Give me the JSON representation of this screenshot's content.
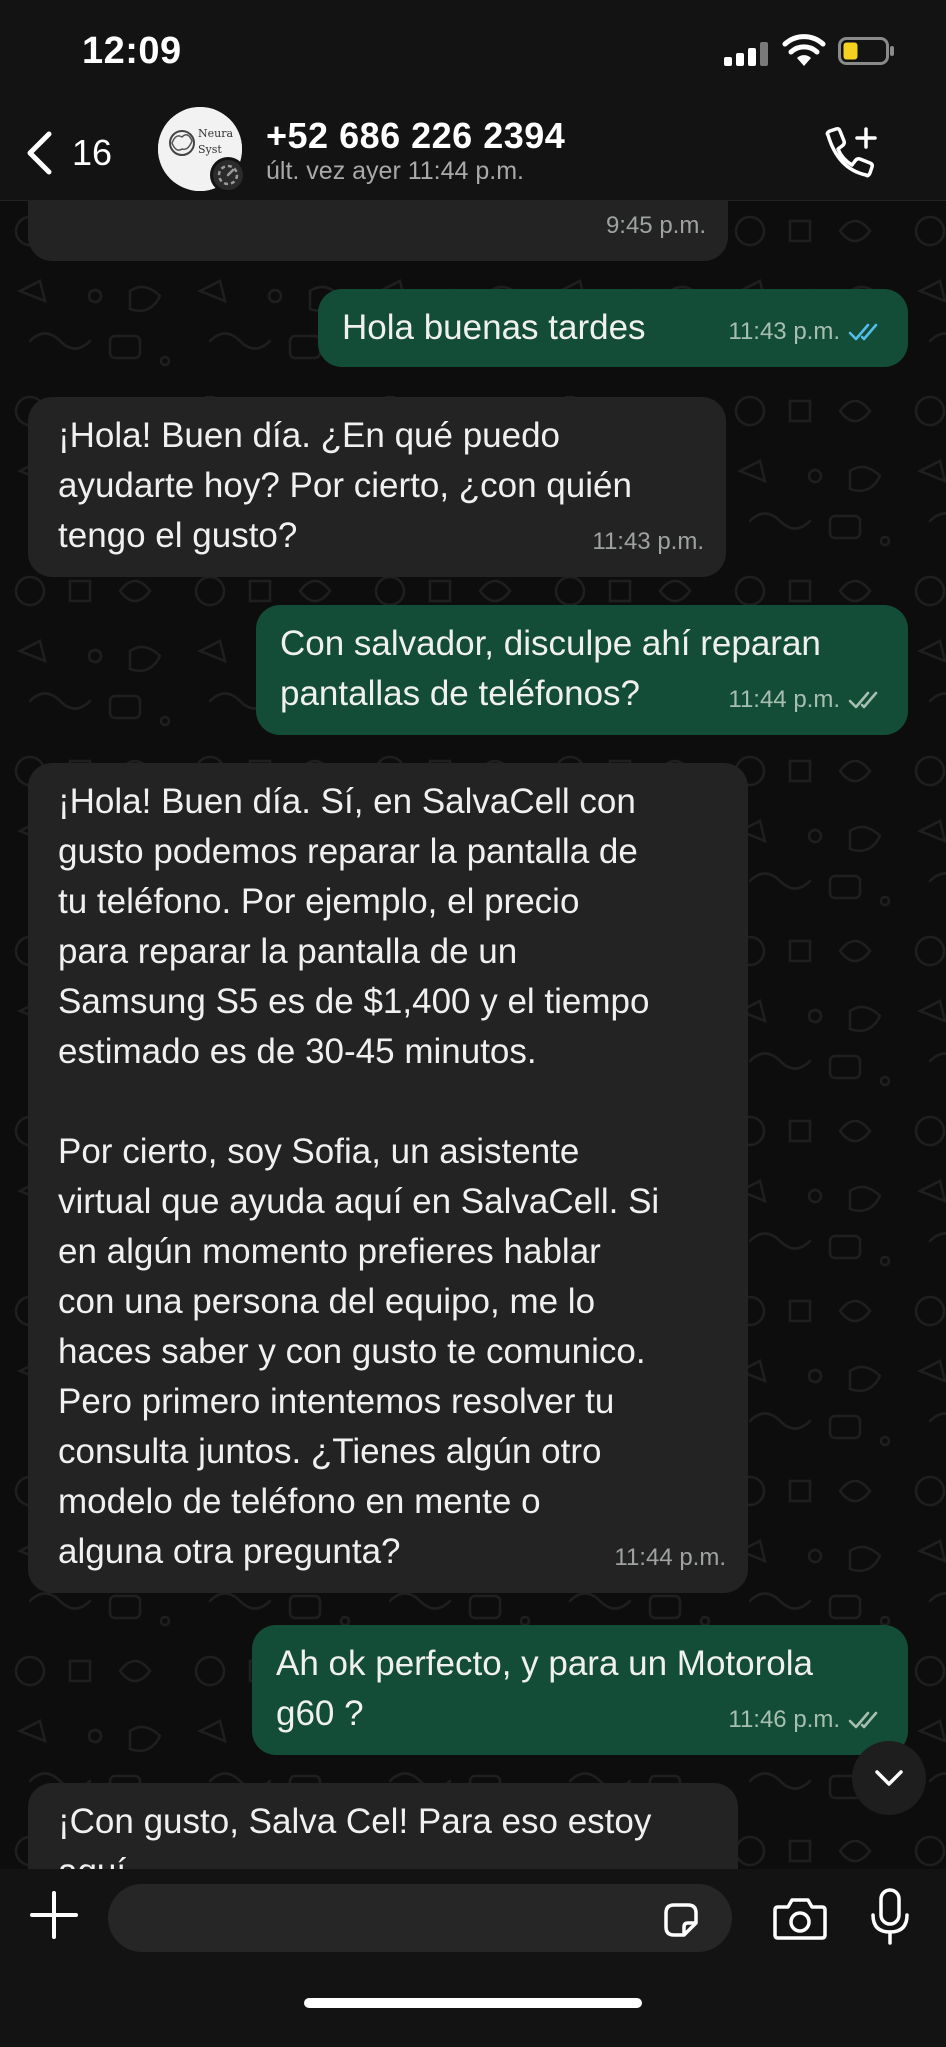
{
  "status_bar": {
    "time": "12:09"
  },
  "header": {
    "back_count": "16",
    "avatar_text_1": "Neura",
    "avatar_text_2": "Syst",
    "contact_name": "+52 686 226 2394",
    "last_seen": "últ. vez ayer 11:44 p.m."
  },
  "messages": [
    {
      "dir": "in",
      "text": "",
      "time": "9:45 p.m.",
      "ticks": ""
    },
    {
      "dir": "out",
      "text": "Hola buenas tardes",
      "time": "11:43 p.m.",
      "ticks": "read"
    },
    {
      "dir": "in",
      "text": "¡Hola! Buen día. ¿En qué puedo\nayudarte hoy? Por cierto, ¿con quién\ntengo el gusto?",
      "time": "11:43 p.m.",
      "ticks": ""
    },
    {
      "dir": "out",
      "text": "Con salvador, disculpe ahí reparan\npantallas de teléfonos?",
      "time": "11:44 p.m.",
      "ticks": "delivered"
    },
    {
      "dir": "in",
      "text": "¡Hola! Buen día. Sí, en SalvaCell con\ngusto podemos reparar la pantalla de\ntu teléfono. Por ejemplo, el precio\npara reparar la pantalla de un\nSamsung S5 es de $1,400 y el tiempo\nestimado es de 30-45 minutos.\n\nPor cierto, soy Sofia, un asistente\nvirtual que ayuda aquí en SalvaCell. Si\nen algún momento prefieres hablar\ncon una persona del equipo, me lo\nhaces saber y con gusto te comunico.\nPero primero intentemos resolver tu\nconsulta juntos. ¿Tienes algún otro\nmodelo de teléfono en mente o\nalguna otra pregunta?",
      "time": "11:44 p.m.",
      "ticks": ""
    },
    {
      "dir": "out",
      "text": "Ah ok perfecto, y para un Motorola\ng60 ?",
      "time": "11:46 p.m.",
      "ticks": "delivered"
    },
    {
      "dir": "in",
      "text": "¡Con gusto, Salva Cel! Para eso estoy\naquí",
      "time": "",
      "ticks": ""
    }
  ],
  "input": {
    "placeholder": ""
  },
  "colors": {
    "incoming_bubble": "#232323",
    "outgoing_bubble": "#144d37",
    "read_tick": "#53bdeb",
    "delivered_tick": "#a6bfb3"
  },
  "icons": {
    "back": "chevron-left-icon",
    "call": "add-call-icon",
    "plus": "plus-icon",
    "sticker": "sticker-icon",
    "camera": "camera-icon",
    "mic": "microphone-icon",
    "scroll": "chevron-down-icon"
  }
}
